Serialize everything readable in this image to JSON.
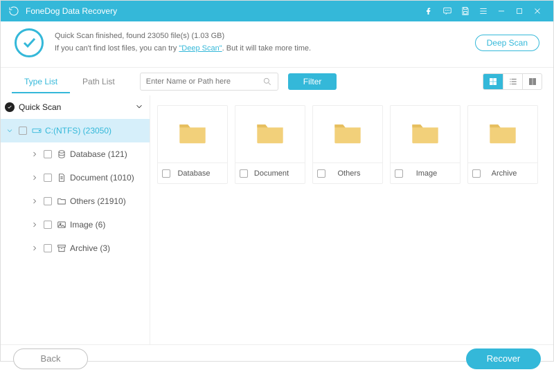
{
  "titlebar": {
    "appName": "FoneDog Data Recovery"
  },
  "scanSummary": {
    "line1": "Quick Scan finished, found 23050 file(s) (1.03 GB)",
    "line2_prefix": "If you can't find lost files, you can try ",
    "deepScanLink": "\"Deep Scan\"",
    "line2_suffix": ". But it will take more time.",
    "deepScanBtn": "Deep Scan"
  },
  "tabs": {
    "typeList": "Type List",
    "pathList": "Path List"
  },
  "search": {
    "placeholder": "Enter Name or Path here"
  },
  "filterBtn": "Filter",
  "sidebar": {
    "root": "Quick Scan",
    "drive": "C:(NTFS) (23050)",
    "items": [
      {
        "label": "Database (121)"
      },
      {
        "label": "Document (1010)"
      },
      {
        "label": "Others (21910)"
      },
      {
        "label": "Image (6)"
      },
      {
        "label": "Archive (3)"
      }
    ]
  },
  "grid": {
    "items": [
      {
        "label": "Database"
      },
      {
        "label": "Document"
      },
      {
        "label": "Others"
      },
      {
        "label": "Image"
      },
      {
        "label": "Archive"
      }
    ]
  },
  "footer": {
    "back": "Back",
    "recover": "Recover"
  }
}
